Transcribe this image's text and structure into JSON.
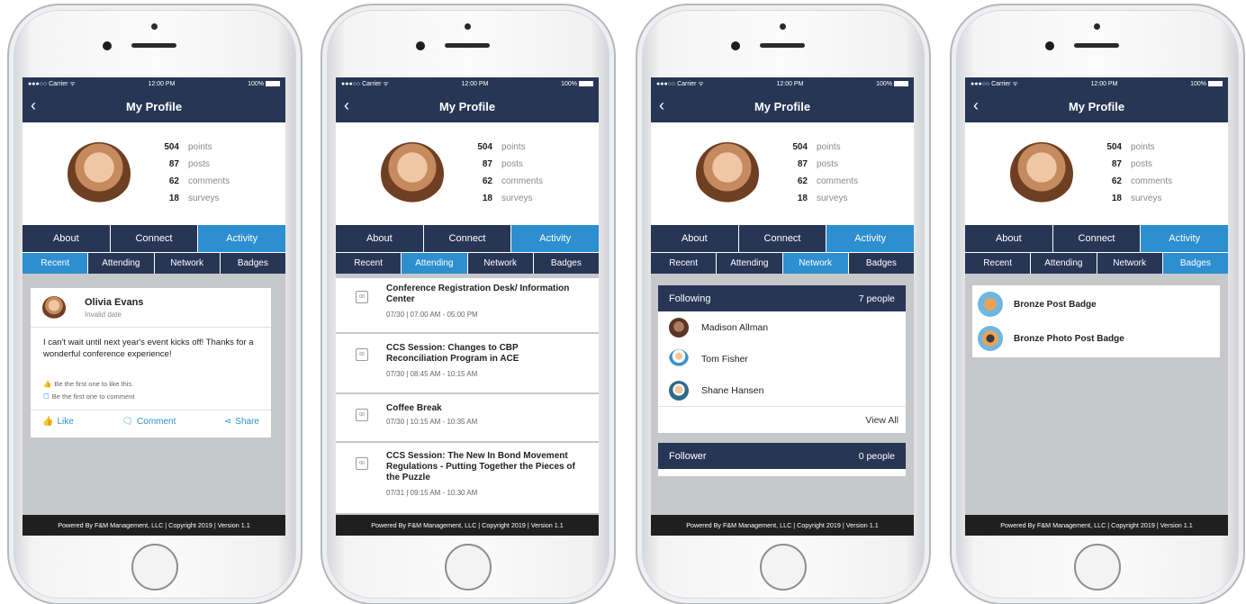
{
  "status": {
    "carrier": "●●●○○ Carrier ᯤ",
    "time": "12:00 PM",
    "battery": "100%"
  },
  "nav": {
    "back_icon": "chevron-left-icon",
    "back_glyph": "‹",
    "title": "My Profile"
  },
  "profile": {
    "stats": [
      {
        "num": "504",
        "label": "points"
      },
      {
        "num": "87",
        "label": "posts"
      },
      {
        "num": "62",
        "label": "comments"
      },
      {
        "num": "18",
        "label": "surveys"
      }
    ]
  },
  "tabs": [
    "About",
    "Connect",
    "Activity"
  ],
  "subtabs": [
    "Recent",
    "Attending",
    "Network",
    "Badges"
  ],
  "footer": "Powered By F&M Management, LLC | Copyright 2019 | Version 1.1",
  "post": {
    "author": "Olivia Evans",
    "date": "Invalid date",
    "body": "I can't wait until next year's event kicks off! Thanks for a wonderful conference experience!",
    "likes_text": "Be the first one to like this.",
    "comments_text": "Be the first one to comment",
    "like_label": "Like",
    "comment_label": "Comment",
    "share_label": "Share"
  },
  "events": [
    {
      "title": "Conference Registration Desk/ Information Center",
      "time": "07/30 | 07:00 AM - 05:00 PM"
    },
    {
      "title": "CCS Session: Changes to CBP Reconciliation Program in ACE",
      "time": "07/30 | 08:45 AM - 10:15 AM"
    },
    {
      "title": "Coffee Break",
      "time": "07/30 | 10:15 AM - 10:35 AM"
    },
    {
      "title": "CCS Session: The New In Bond Movement Regulations - Putting Together the Pieces of the Puzzle",
      "time": "07/31 | 09:15 AM - 10:30 AM"
    }
  ],
  "calendar_icon_text": "00",
  "network": {
    "following_label": "Following",
    "following_count": "7 people",
    "people": [
      "Madison Allman",
      "Tom Fisher",
      "Shane Hansen"
    ],
    "view_all": "View All",
    "follower_label": "Follower",
    "follower_count": "0 people"
  },
  "badges": [
    "Bronze Post Badge",
    "Bronze Photo Post Badge"
  ],
  "colors": {
    "navy": "#283656",
    "accent": "#2d8fd0",
    "footer": "#1f1f1f"
  }
}
